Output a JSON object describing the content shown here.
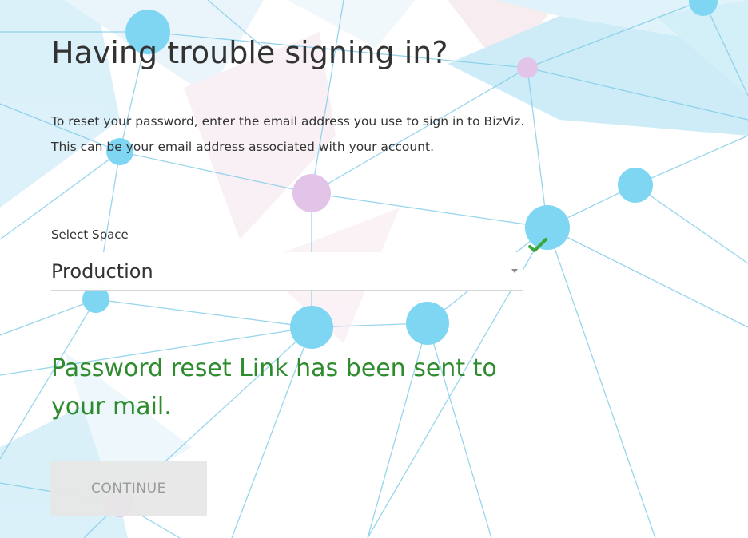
{
  "page": {
    "title": "Having trouble signing in?",
    "description_lines": [
      "To reset your password, enter the email address you use to sign in to BizViz.",
      "This can be your email address associated with your account."
    ]
  },
  "form": {
    "space_label": "Select Space",
    "space_value": "Production",
    "space_valid_icon": "check-icon"
  },
  "status": {
    "message_lines": [
      "Password reset Link has been sent to",
      "your mail."
    ],
    "color": "#2e8b2e"
  },
  "actions": {
    "continue_label": "CONTINUE"
  },
  "theme": {
    "node_blue": "#7fd6f2",
    "node_pink": "#e3c4e9",
    "line_color": "#7ecbe8",
    "check_green": "#3aa63a"
  }
}
